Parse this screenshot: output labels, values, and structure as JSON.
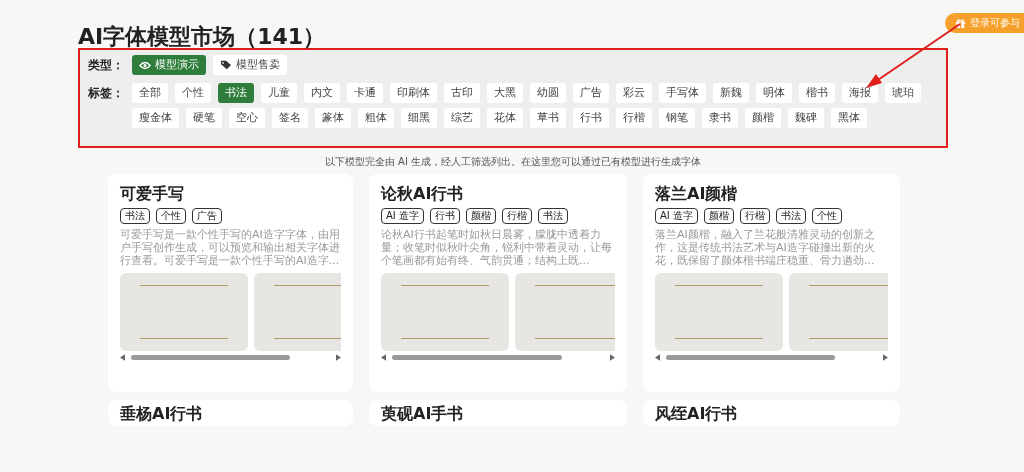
{
  "page_title": "AI字体模型市场（141）",
  "login_badge": {
    "label": "登录可参与"
  },
  "filters": {
    "type_label": "类型：",
    "types": [
      {
        "label": "模型演示",
        "selected": true
      },
      {
        "label": "模型售卖",
        "selected": false
      }
    ],
    "tag_label": "标签：",
    "tags": [
      {
        "label": "全部",
        "selected": false
      },
      {
        "label": "个性",
        "selected": false
      },
      {
        "label": "书法",
        "selected": true
      },
      {
        "label": "儿童",
        "selected": false
      },
      {
        "label": "内文",
        "selected": false
      },
      {
        "label": "卡通",
        "selected": false
      },
      {
        "label": "印刷体",
        "selected": false
      },
      {
        "label": "古印",
        "selected": false
      },
      {
        "label": "大黑",
        "selected": false
      },
      {
        "label": "幼圆",
        "selected": false
      },
      {
        "label": "广告",
        "selected": false
      },
      {
        "label": "彩云",
        "selected": false
      },
      {
        "label": "手写体",
        "selected": false
      },
      {
        "label": "新魏",
        "selected": false
      },
      {
        "label": "明体",
        "selected": false
      },
      {
        "label": "楷书",
        "selected": false
      },
      {
        "label": "海报",
        "selected": false
      },
      {
        "label": "琥珀",
        "selected": false
      },
      {
        "label": "瘦金体",
        "selected": false
      },
      {
        "label": "硬笔",
        "selected": false
      },
      {
        "label": "空心",
        "selected": false
      },
      {
        "label": "签名",
        "selected": false
      },
      {
        "label": "篆体",
        "selected": false
      },
      {
        "label": "粗体",
        "selected": false
      },
      {
        "label": "细黑",
        "selected": false
      },
      {
        "label": "综艺",
        "selected": false
      },
      {
        "label": "花体",
        "selected": false
      },
      {
        "label": "草书",
        "selected": false
      },
      {
        "label": "行书",
        "selected": false
      },
      {
        "label": "行楷",
        "selected": false
      },
      {
        "label": "钢笔",
        "selected": false
      },
      {
        "label": "隶书",
        "selected": false
      },
      {
        "label": "颜楷",
        "selected": false
      },
      {
        "label": "魏碑",
        "selected": false
      },
      {
        "label": "黑体",
        "selected": false
      }
    ]
  },
  "notice": "以下模型完全由 AI 生成，经人工筛选列出。在这里您可以通过已有模型进行生成字体",
  "cards": [
    {
      "title": "可爱手写",
      "tags": [
        "书法",
        "个性",
        "广告"
      ],
      "description": "可爱手写是一款个性手写的AI造字字体，由用户手写创作生成，可以预览和输出相关字体进行查看。可爱手写是一款个性手写的AI造字..."
    },
    {
      "title": "论秋AI行书",
      "tags": [
        "AI 造字",
        "行书",
        "颜楷",
        "行楷",
        "书法"
      ],
      "description": "论秋AI行书起笔时如秋日晨雾，朦胧中透着力量；收笔时似秋叶尖角，锐利中带着灵动，让每个笔画都有始有终、气韵贯通；结构上既..."
    },
    {
      "title": "落兰AI颜楷",
      "tags": [
        "AI 造字",
        "颜楷",
        "行楷",
        "书法",
        "个性"
      ],
      "description": "落兰AI颜楷，融入了兰花般清雅灵动的创新之作，这是传统书法艺术与AI造字碰撞出新的火花，既保留了颜体楷书端庄稳重、骨力遒劲..."
    },
    {
      "title": "垂杨AI行书"
    },
    {
      "title": "萸砚AI手书"
    },
    {
      "title": "风绖AI行书"
    }
  ]
}
